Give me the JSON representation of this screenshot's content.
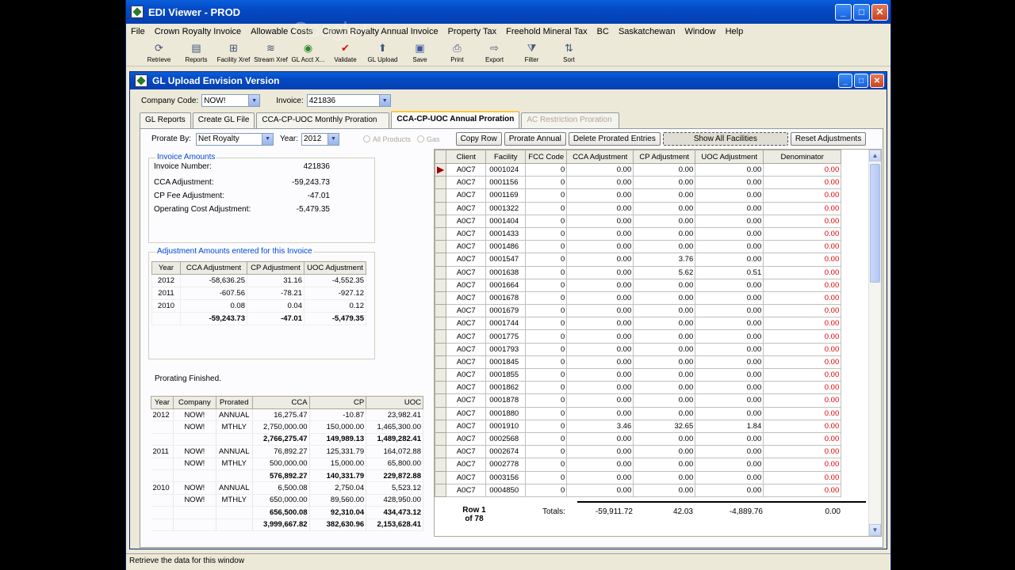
{
  "app": {
    "title": "EDI Viewer  - PROD",
    "status": "Retrieve the data for this window",
    "watermark": "Google+"
  },
  "menu": [
    "File",
    "Crown Royalty Invoice",
    "Allowable Costs",
    "Crown Royalty Annual Invoice",
    "Property Tax",
    "Freehold Mineral Tax",
    "BC",
    "Saskatchewan",
    "Window",
    "Help"
  ],
  "toolbar": [
    {
      "label": "Retrieve",
      "icon": "retrieve-icon"
    },
    {
      "label": "Reports",
      "icon": "reports-icon"
    },
    {
      "label": "Facility Xref",
      "icon": "facility-xref-icon"
    },
    {
      "label": "Stream Xref",
      "icon": "stream-xref-icon"
    },
    {
      "label": "GL Acct X...",
      "icon": "gl-acct-icon"
    },
    {
      "label": "Validate",
      "icon": "validate-icon"
    },
    {
      "label": "GL Upload",
      "icon": "gl-upload-icon"
    },
    {
      "label": "Save",
      "icon": "save-icon"
    },
    {
      "label": "Print",
      "icon": "print-icon"
    },
    {
      "label": "Export",
      "icon": "export-icon"
    },
    {
      "label": "Filter",
      "icon": "filter-icon"
    },
    {
      "label": "Sort",
      "icon": "sort-icon"
    }
  ],
  "inner": {
    "title": "GL Upload Envision Version",
    "company_label": "Company Code:",
    "company_value": "NOW!",
    "invoice_label": "Invoice:",
    "invoice_value": "421836",
    "tabs": [
      "GL Reports",
      "Create GL File",
      "CCA-CP-UOC Monthly Proration",
      "CCA-CP-UOC Annual Proration",
      "AC Restriction Proration"
    ]
  },
  "panel": {
    "prorate_by_label": "Prorate By:",
    "prorate_by_value": "Net Royalty",
    "year_label": "Year:",
    "year_value": "2012",
    "radio_all": "All Products",
    "radio_gas": "Gas",
    "buttons": [
      "Copy Row",
      "Prorate Annual",
      "Delete Prorated Entries",
      "Show All Facilities",
      "Reset Adjustments"
    ],
    "invoice_amounts": {
      "title": "Invoice Amounts",
      "rows": [
        {
          "label": "Invoice Number:",
          "value": "421836"
        },
        {
          "label": "CCA Adjustment:",
          "value": "-59,243.73"
        },
        {
          "label": "CP Fee Adjustment:",
          "value": "-47.01"
        },
        {
          "label": "Operating Cost Adjustment:",
          "value": "-5,479.35"
        }
      ]
    },
    "adjustments": {
      "title": "Adjustment Amounts entered for this Invoice",
      "headers": [
        "Year",
        "CCA Adjustment",
        "CP Adjustment",
        "UOC Adjustment"
      ],
      "rows": [
        [
          "2012",
          "-58,636.25",
          "31.16",
          "-4,552.35"
        ],
        [
          "2011",
          "-607.56",
          "-78.21",
          "-927.12"
        ],
        [
          "2010",
          "0.08",
          "0.04",
          "0.12"
        ]
      ],
      "total": [
        "",
        "-59,243.73",
        "-47.01",
        "-5,479.35"
      ]
    },
    "prorating_status": "Prorating Finished.",
    "summary": {
      "headers": [
        "Year",
        "Company",
        "Prorated",
        "CCA",
        "CP",
        "UOC"
      ],
      "rows": [
        {
          "cells": [
            "2012",
            "NOW!",
            "ANNUAL",
            "16,275.47",
            "-10.87",
            "23,982.41"
          ],
          "bold": false
        },
        {
          "cells": [
            "",
            "NOW!",
            "MTHLY",
            "2,750,000.00",
            "150,000.00",
            "1,465,300.00"
          ],
          "bold": false
        },
        {
          "cells": [
            "",
            "",
            "",
            "2,766,275.47",
            "149,989.13",
            "1,489,282.41"
          ],
          "bold": true
        },
        {
          "cells": [
            "2011",
            "NOW!",
            "ANNUAL",
            "76,892.27",
            "125,331.79",
            "164,072.88"
          ],
          "bold": false
        },
        {
          "cells": [
            "",
            "NOW!",
            "MTHLY",
            "500,000.00",
            "15,000.00",
            "65,800.00"
          ],
          "bold": false
        },
        {
          "cells": [
            "",
            "",
            "",
            "576,892.27",
            "140,331.79",
            "229,872.88"
          ],
          "bold": true
        },
        {
          "cells": [
            "2010",
            "NOW!",
            "ANNUAL",
            "6,500.08",
            "2,750.04",
            "5,523.12"
          ],
          "bold": false
        },
        {
          "cells": [
            "",
            "NOW!",
            "MTHLY",
            "650,000.00",
            "89,560.00",
            "428,950.00"
          ],
          "bold": false
        },
        {
          "cells": [
            "",
            "",
            "",
            "656,500.08",
            "92,310.04",
            "434,473.12"
          ],
          "bold": true
        },
        {
          "cells": [
            "",
            "",
            "",
            "3,999,667.82",
            "382,630.96",
            "2,153,628.41"
          ],
          "bold": true
        }
      ]
    },
    "grid": {
      "headers": [
        "Client",
        "Facility",
        "FCC Code",
        "CCA Adjustment",
        "CP Adjustment",
        "UOC Adjustment",
        "Denominator"
      ],
      "rows": [
        [
          "A0C7",
          "0001024",
          "0",
          "0.00",
          "0.00",
          "0.00",
          "0.00"
        ],
        [
          "A0C7",
          "0001156",
          "0",
          "0.00",
          "0.00",
          "0.00",
          "0.00"
        ],
        [
          "A0C7",
          "0001169",
          "0",
          "0.00",
          "0.00",
          "0.00",
          "0.00"
        ],
        [
          "A0C7",
          "0001322",
          "0",
          "0.00",
          "0.00",
          "0.00",
          "0.00"
        ],
        [
          "A0C7",
          "0001404",
          "0",
          "0.00",
          "0.00",
          "0.00",
          "0.00"
        ],
        [
          "A0C7",
          "0001433",
          "0",
          "0.00",
          "0.00",
          "0.00",
          "0.00"
        ],
        [
          "A0C7",
          "0001486",
          "0",
          "0.00",
          "0.00",
          "0.00",
          "0.00"
        ],
        [
          "A0C7",
          "0001547",
          "0",
          "0.00",
          "3.76",
          "0.00",
          "0.00"
        ],
        [
          "A0C7",
          "0001638",
          "0",
          "0.00",
          "5.62",
          "0.51",
          "0.00"
        ],
        [
          "A0C7",
          "0001664",
          "0",
          "0.00",
          "0.00",
          "0.00",
          "0.00"
        ],
        [
          "A0C7",
          "0001678",
          "0",
          "0.00",
          "0.00",
          "0.00",
          "0.00"
        ],
        [
          "A0C7",
          "0001679",
          "0",
          "0.00",
          "0.00",
          "0.00",
          "0.00"
        ],
        [
          "A0C7",
          "0001744",
          "0",
          "0.00",
          "0.00",
          "0.00",
          "0.00"
        ],
        [
          "A0C7",
          "0001775",
          "0",
          "0.00",
          "0.00",
          "0.00",
          "0.00"
        ],
        [
          "A0C7",
          "0001793",
          "0",
          "0.00",
          "0.00",
          "0.00",
          "0.00"
        ],
        [
          "A0C7",
          "0001845",
          "0",
          "0.00",
          "0.00",
          "0.00",
          "0.00"
        ],
        [
          "A0C7",
          "0001855",
          "0",
          "0.00",
          "0.00",
          "0.00",
          "0.00"
        ],
        [
          "A0C7",
          "0001862",
          "0",
          "0.00",
          "0.00",
          "0.00",
          "0.00"
        ],
        [
          "A0C7",
          "0001878",
          "0",
          "0.00",
          "0.00",
          "0.00",
          "0.00"
        ],
        [
          "A0C7",
          "0001880",
          "0",
          "0.00",
          "0.00",
          "0.00",
          "0.00"
        ],
        [
          "A0C7",
          "0001910",
          "0",
          "3.46",
          "32.65",
          "1.84",
          "0.00"
        ],
        [
          "A0C7",
          "0002568",
          "0",
          "0.00",
          "0.00",
          "0.00",
          "0.00"
        ],
        [
          "A0C7",
          "0002674",
          "0",
          "0.00",
          "0.00",
          "0.00",
          "0.00"
        ],
        [
          "A0C7",
          "0002778",
          "0",
          "0.00",
          "0.00",
          "0.00",
          "0.00"
        ],
        [
          "A0C7",
          "0003156",
          "0",
          "0.00",
          "0.00",
          "0.00",
          "0.00"
        ],
        [
          "A0C7",
          "0004850",
          "0",
          "0.00",
          "0.00",
          "0.00",
          "0.00"
        ]
      ],
      "row_indicator": "Row 1",
      "row_of": "of 78",
      "totals_label": "Totals:",
      "totals": [
        "-59,911.72",
        "42.03",
        "-4,889.76",
        "0.00"
      ]
    }
  },
  "colors": {
    "title_blue": "#0549c4",
    "denominator_red": "#e00000",
    "group_title": "#0046d5"
  }
}
